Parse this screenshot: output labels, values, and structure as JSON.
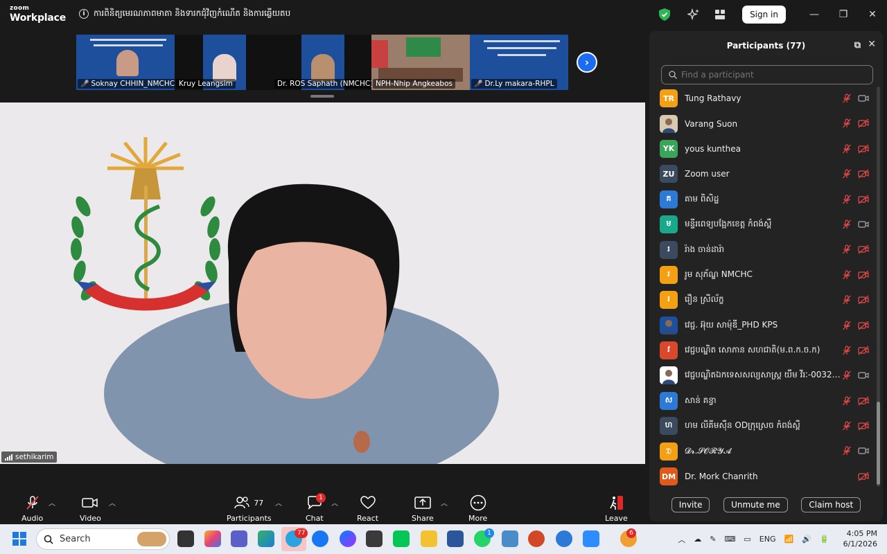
{
  "app": {
    "brand_line1": "zoom",
    "brand_line2": "Workplace",
    "meeting_title": "ការពិនិត្យមេរណភាពមាតា និងទារកជុំវិញកំណើត និងការឆ្លើយតប",
    "sign_in": "Sign in"
  },
  "thumbnails": [
    {
      "name": "Soknay CHHIN_NMCHC",
      "muted": true
    },
    {
      "name": "Kruy Leangsim",
      "muted": false
    },
    {
      "name": "Dr. ROS Saphath (NMCHC)",
      "muted": false
    },
    {
      "name": "NPH-Nhip Angkeabos",
      "muted": false
    },
    {
      "name": "Dr.Ly makara-RHPL",
      "muted": true
    }
  ],
  "main": {
    "speaker": "sethikarim"
  },
  "panel": {
    "title": "Participants (77)",
    "search_placeholder": "Find a participant",
    "participants": [
      {
        "initials": "TR",
        "name": "Tung Rathavy",
        "color": "#f4a015",
        "cam": "on"
      },
      {
        "initials": "",
        "name": "Varang Suon",
        "color": "#d8c9b0",
        "cam": "off",
        "photo": true
      },
      {
        "initials": "YK",
        "name": "yous kunthea",
        "color": "#3aa45b",
        "cam": "off"
      },
      {
        "initials": "ZU",
        "name": "Zoom user",
        "color": "#3b4a5e",
        "cam": "off"
      },
      {
        "initials": "គ",
        "name": "គាម ពិសិដ្ឋ",
        "color": "#2d7ad6",
        "cam": "off"
      },
      {
        "initials": "ម",
        "name": "មន្ទីរពេទ្យបង្អែកខេត្ត កំពង់ស្ពឺ",
        "color": "#1aa88a",
        "cam": "on"
      },
      {
        "initials": "រ",
        "name": "រ៉ាង ចាន់ដារ៉ា",
        "color": "#3b4a5e",
        "cam": "off"
      },
      {
        "initials": "រ",
        "name": "រូម សុភ័ណ្ឌ NMCHC",
        "color": "#f4a015",
        "cam": "off"
      },
      {
        "initials": "រ",
        "name": "រឿន ស្រីល័ក្ខ",
        "color": "#f4a015",
        "cam": "off"
      },
      {
        "initials": "",
        "name": "វេជ្ជ. អ៊ុយ សាម៉ុឌី_PHD KPS",
        "color": "#1d4f9c",
        "cam": "off",
        "photo": true
      },
      {
        "initials": "វ",
        "name": "វេជ្ជបណ្ឌិត សោភាន សហជាតិ(ម.ព.ក.ច.ក)",
        "color": "#d9482b",
        "cam": "off"
      },
      {
        "initials": "",
        "name": "វេជ្ជបណ្ឌិតឯកទេសសល្យសាស្ត្រ យឹម វីរៈ-0032…",
        "color": "#ffffff",
        "cam": "on",
        "photo": true
      },
      {
        "initials": "ស",
        "name": "សាន់ គន្ធា",
        "color": "#2d7ad6",
        "cam": "off"
      },
      {
        "initials": "ហ",
        "name": "ហម លីគីមស៊ឺន ODក្រុស្រេច កំពង់ស្ពឺ",
        "color": "#3b4a5e",
        "cam": "off"
      },
      {
        "initials": "𝔇",
        "name": "𝓓𝓻.𝓢𝓞𝓡𝓨𝓐",
        "color": "#f4a015",
        "cam": "on"
      },
      {
        "initials": "DM",
        "name": "Dr. Mork Chanrith",
        "color": "#e05a1c",
        "cam": "off",
        "no_mic": true
      }
    ],
    "invite": "Invite",
    "unmute_me": "Unmute me",
    "claim_host": "Claim host"
  },
  "toolbar": {
    "audio": "Audio",
    "video": "Video",
    "participants": "Participants",
    "participants_count": "77",
    "chat": "Chat",
    "chat_badge": "1",
    "react": "React",
    "share": "Share",
    "more": "More",
    "leave": "Leave"
  },
  "taskbar": {
    "search": "Search",
    "telegram_badge": "77",
    "whatsapp_badge": "1",
    "notif_badge": "6",
    "lang": "ENG",
    "time": "4:05 PM",
    "date": "6/1/2026"
  },
  "colors": {
    "accent": "#1b6cf2",
    "muted_red": "#e84a4a",
    "panel_bg": "#232323"
  }
}
